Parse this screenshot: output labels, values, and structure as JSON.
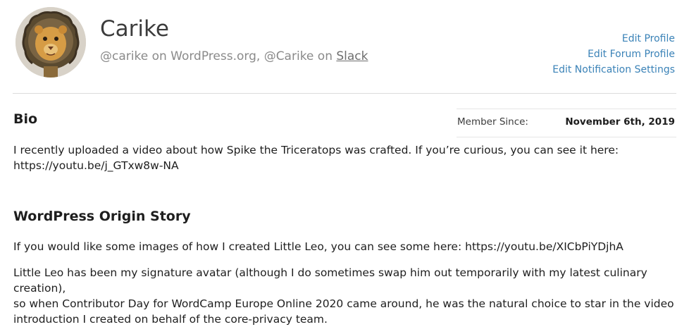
{
  "profile": {
    "name": "Carike",
    "handles_prefix": "@carike on WordPress.org, @Carike on ",
    "slack_link": "Slack",
    "avatar_icon": "lion-avatar"
  },
  "actions": {
    "edit_profile": "Edit Profile",
    "edit_forum_profile": "Edit Forum Profile",
    "edit_notification_settings": "Edit Notification Settings"
  },
  "bio": {
    "title": "Bio",
    "line1": "I recently uploaded a video about how Spike the Triceratops was crafted. If you’re curious, you can see it here:",
    "line2": "https://youtu.be/j_GTxw8w-NA"
  },
  "member": {
    "label": "Member Since:",
    "value": "November 6th, 2019"
  },
  "origin_story": {
    "title": "WordPress Origin Story",
    "paragraph1": "If you would like some images of how I created Little Leo, you can see some here: https://youtu.be/XICbPiYDjhA",
    "paragraph2_line1": "Little Leo has been my signature avatar (although I do sometimes swap him out temporarily with my latest culinary creation),",
    "paragraph2_line2": "so when Contributor Day for WordCamp Europe Online 2020 came around, he was the natural choice to star in the video",
    "paragraph2_line3": "introduction I created on behalf of the core-privacy team."
  },
  "colors": {
    "link": "#3a82b7",
    "text": "#1e1e1e",
    "muted": "#8a8a8a",
    "divider": "#dcdcdc"
  }
}
